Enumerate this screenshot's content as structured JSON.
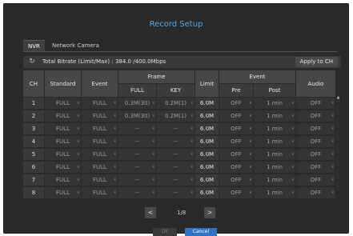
{
  "title": "Record Setup",
  "tabs": [
    "NVR",
    "Network Camera"
  ],
  "bitrate": "Total Bitrate (Limit/Max) : 384.0 /400.0Mbps",
  "apply_label": "Apply to CH",
  "headers": {
    "ch": "CH",
    "standard": "Standard",
    "event": "Event",
    "frame": "Frame",
    "full": "FULL",
    "key": "KEY",
    "limit": "Limit",
    "event_group": "Event",
    "pre": "Pre",
    "post": "Post",
    "audio": "Audio"
  },
  "rows": [
    {
      "ch": "1",
      "standard": "FULL",
      "event": "FULL",
      "full": "0.3M(30)",
      "key": "0.2M(1)",
      "limit": "6.0M",
      "pre": "OFF",
      "post": "1 min",
      "audio": "OFF"
    },
    {
      "ch": "2",
      "standard": "FULL",
      "event": "FULL",
      "full": "0.3M(30)",
      "key": "0.2M(1)",
      "limit": "6.0M",
      "pre": "OFF",
      "post": "1 min",
      "audio": "OFF"
    },
    {
      "ch": "3",
      "standard": "FULL",
      "event": "FULL",
      "full": "--",
      "key": "--",
      "limit": "6.0M",
      "pre": "OFF",
      "post": "1 min",
      "audio": "OFF"
    },
    {
      "ch": "4",
      "standard": "FULL",
      "event": "FULL",
      "full": "--",
      "key": "--",
      "limit": "6.0M",
      "pre": "OFF",
      "post": "1 min",
      "audio": "OFF"
    },
    {
      "ch": "5",
      "standard": "FULL",
      "event": "FULL",
      "full": "--",
      "key": "--",
      "limit": "6.0M",
      "pre": "OFF",
      "post": "1 min",
      "audio": "OFF"
    },
    {
      "ch": "6",
      "standard": "FULL",
      "event": "FULL",
      "full": "--",
      "key": "--",
      "limit": "6.0M",
      "pre": "OFF",
      "post": "1 min",
      "audio": "OFF"
    },
    {
      "ch": "7",
      "standard": "FULL",
      "event": "FULL",
      "full": "--",
      "key": "--",
      "limit": "6.0M",
      "pre": "OFF",
      "post": "1 min",
      "audio": "OFF"
    },
    {
      "ch": "8",
      "standard": "FULL",
      "event": "FULL",
      "full": "--",
      "key": "--",
      "limit": "6.0M",
      "pre": "OFF",
      "post": "1 min",
      "audio": "OFF"
    }
  ],
  "pager": {
    "prev": "<",
    "page": "1/8",
    "next": ">"
  },
  "buttons": {
    "ok": "OK",
    "cancel": "Cancel"
  },
  "colors": {
    "title": "#5aa6e6",
    "cancel": "#2f73c7"
  }
}
